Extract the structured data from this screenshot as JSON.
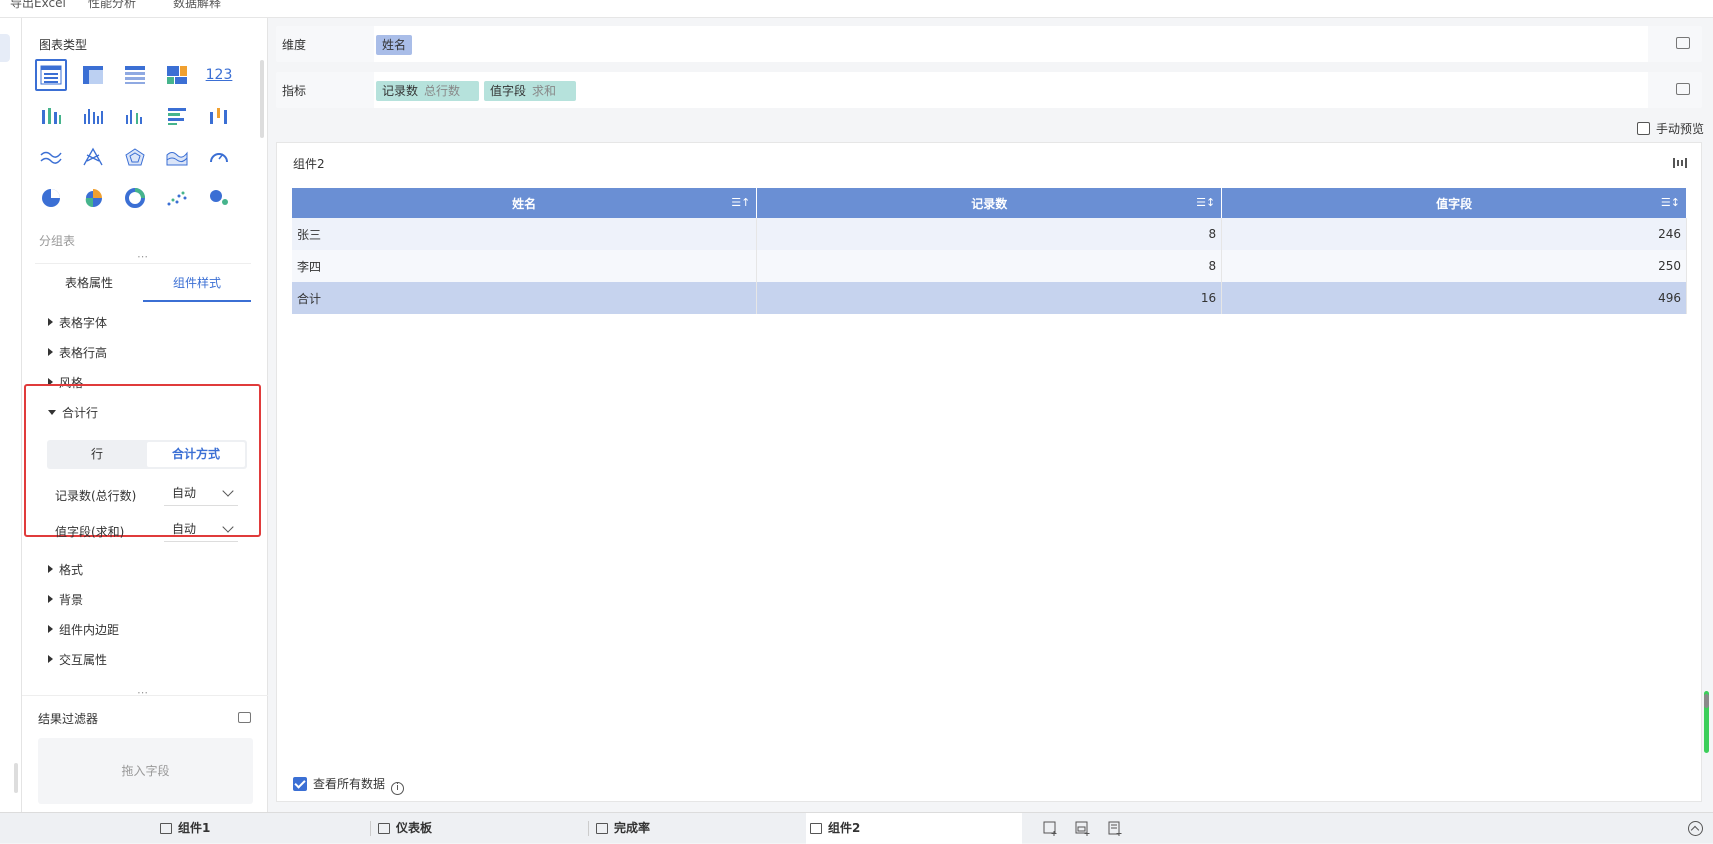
{
  "topbar": {
    "items": [
      "导出Excel",
      "性能分析",
      "数据解释"
    ]
  },
  "left_strip": {
    "paren": ")"
  },
  "chart_panel": {
    "title": "图表类型",
    "icons": [
      "table-icon",
      "cross-table-icon",
      "detail-table-icon",
      "treemap-icon",
      "kpi-number-icon",
      "stacked-bar-icon",
      "grouped-column-icon",
      "column-icon",
      "horizontal-bar-icon",
      "range-column-icon",
      "line-icon",
      "radar-line-icon",
      "radar-icon",
      "area-icon",
      "gauge-icon",
      "pie-icon",
      "rose-pie-icon",
      "donut-icon",
      "scatter-icon",
      "bubble-icon"
    ],
    "kpi_text": "123",
    "group_label": "分组表"
  },
  "tabs": {
    "table_props": "表格属性",
    "component_style": "组件样式"
  },
  "accordion": {
    "font": "表格字体",
    "row_height": "表格行高",
    "style": "风格",
    "total_row": "合计行",
    "format": "格式",
    "background": "背景",
    "padding": "组件内边距",
    "interaction": "交互属性"
  },
  "total_row": {
    "seg_row": "行",
    "seg_method": "合计方式",
    "field1_label": "记录数(总行数)",
    "field1_value": "自动",
    "field2_label": "值字段(求和)",
    "field2_value": "自动"
  },
  "filter": {
    "title": "结果过滤器",
    "placeholder": "拖入字段"
  },
  "dimension": {
    "label": "维度",
    "chip": "姓名",
    "chip_color": "#a9bde8"
  },
  "metric": {
    "label": "指标",
    "chips": [
      {
        "name": "记录数",
        "agg": "总行数",
        "color": "#b6e2dc"
      },
      {
        "name": "值字段",
        "agg": "求和",
        "color": "#b6e2dc"
      }
    ]
  },
  "manual_preview": "手动预览",
  "component": {
    "title": "组件2",
    "columns": [
      "姓名",
      "记录数",
      "值字段"
    ],
    "rows": [
      [
        "张三",
        "8",
        "246"
      ],
      [
        "李四",
        "8",
        "250"
      ]
    ],
    "total": [
      "合计",
      "16",
      "496"
    ],
    "header_color": "#6a8fd4"
  },
  "view_all": "查看所有数据",
  "bottom_tabs": [
    "组件1",
    "仪表板",
    "完成率",
    "组件2"
  ],
  "active_tab": "组件2"
}
